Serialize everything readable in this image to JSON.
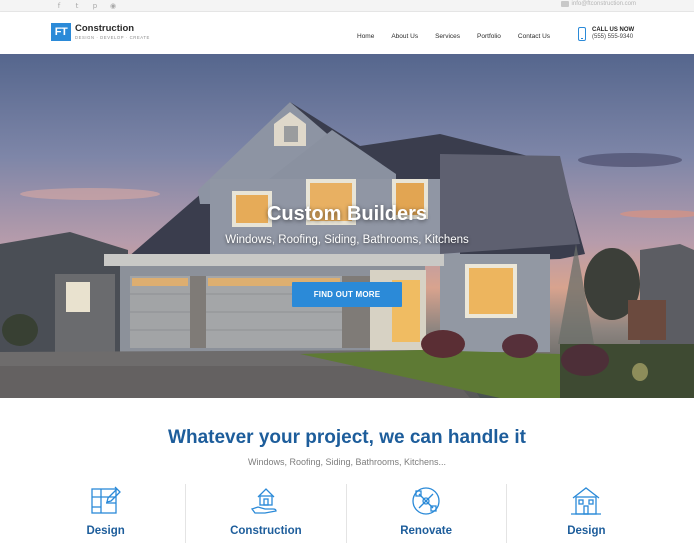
{
  "topbar": {
    "social": [
      {
        "icon": "facebook-icon",
        "glyph": "f"
      },
      {
        "icon": "twitter-icon",
        "glyph": "t"
      },
      {
        "icon": "pinterest-icon",
        "glyph": "p"
      },
      {
        "icon": "rss-icon",
        "glyph": "◉"
      }
    ],
    "email": "info@ftconstruction.com"
  },
  "header": {
    "logo_mark": "FT",
    "logo_name": "Construction",
    "logo_tagline": "DESIGN · DEVELOP · CREATE",
    "nav": [
      "Home",
      "About Us",
      "Services",
      "Portfolio",
      "Contact Us"
    ],
    "call_label": "CALL US NOW",
    "phone": "(555) 555-9340"
  },
  "hero": {
    "title": "Custom Builders",
    "subtitle": "Windows, Roofing, Siding, Bathrooms, Kitchens",
    "cta": "FIND OUT MORE"
  },
  "section": {
    "title": "Whatever your project, we can handle it",
    "subtitle": "Windows, Roofing, Siding, Bathrooms, Kitchens..."
  },
  "services": [
    {
      "label": "Design",
      "icon": "blueprint-icon"
    },
    {
      "label": "Construction",
      "icon": "hand-house-icon"
    },
    {
      "label": "Renovate",
      "icon": "tools-icon"
    },
    {
      "label": "Design",
      "icon": "building-icon"
    }
  ],
  "colors": {
    "accent": "#2b8ad8",
    "heading": "#1d5d9b",
    "muted": "#7d7d7d"
  }
}
